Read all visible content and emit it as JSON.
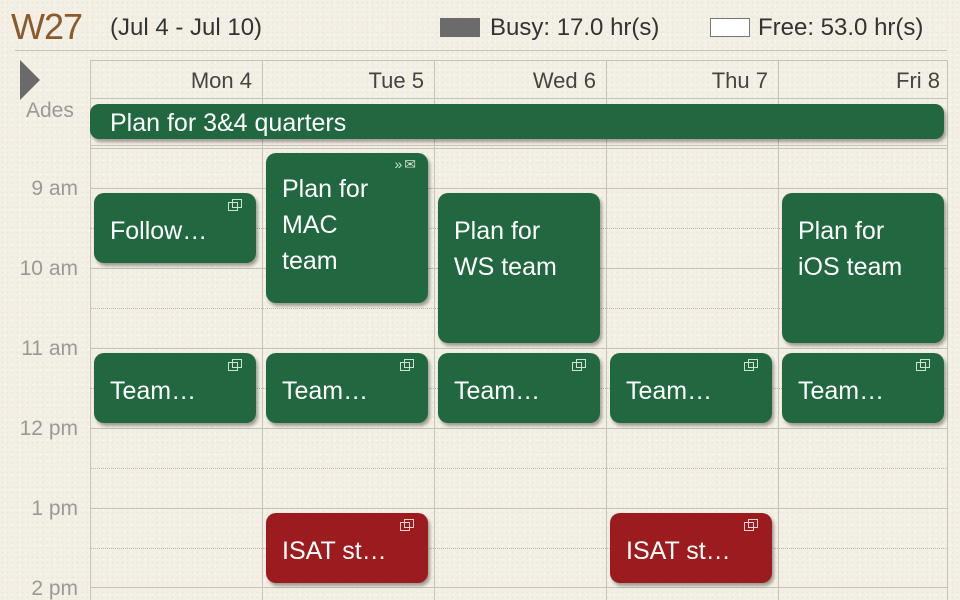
{
  "header": {
    "week": "W27",
    "range": "(Jul 4 - Jul 10)",
    "busy_label": "Busy: 17.0 hr(s)",
    "free_label": "Free: 53.0 hr(s)",
    "busy_color": "#6b6b6b",
    "free_color": "#ffffff"
  },
  "allday_label": "Ades",
  "days": [
    "Mon 4",
    "Tue 5",
    "Wed 6",
    "Thu 7",
    "Fri 8"
  ],
  "times": [
    "9 am",
    "10 am",
    "11 am",
    "12 pm",
    "1 pm",
    "2 pm"
  ],
  "events": {
    "allday": "Plan for 3&4 quarters",
    "mon_follow": "Follow…",
    "tue_plan": "Plan for\nMAC\nteam",
    "wed_plan": "Plan for\nWS team",
    "fri_plan": "Plan for\niOS team",
    "mon_team": "Team…",
    "tue_team": "Team…",
    "wed_team": "Team…",
    "thu_team": "Team…",
    "fri_team": "Team…",
    "tue_isat": "ISAT st…",
    "thu_isat": "ISAT st…"
  },
  "colors": {
    "event_green": "#216840",
    "event_red": "#9b1b1e",
    "week_number": "#8b5a2b"
  },
  "icons": {
    "event_repeat": "repeat-icon",
    "event_expand": "chevron-down-icon",
    "event_mail": "mail-icon",
    "nav_next": "triangle-right-icon"
  }
}
